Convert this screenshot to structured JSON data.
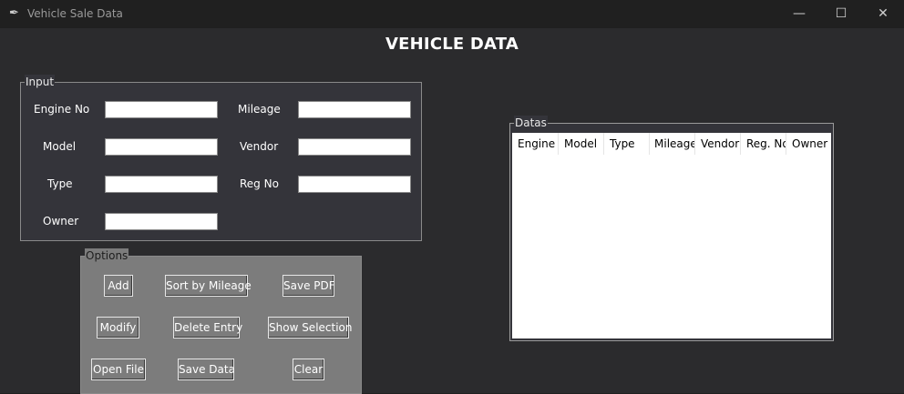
{
  "window": {
    "title": "Vehicle Sale Data",
    "controls": {
      "minimize": "—",
      "maximize": "☐",
      "close": "✕"
    }
  },
  "heading": "VEHICLE DATA",
  "input_frame": {
    "label": "Input",
    "fields": {
      "engine_no": {
        "label": "Engine No",
        "value": ""
      },
      "mileage": {
        "label": "Mileage",
        "value": ""
      },
      "model": {
        "label": "Model",
        "value": ""
      },
      "vendor": {
        "label": "Vendor",
        "value": ""
      },
      "type": {
        "label": "Type",
        "value": ""
      },
      "reg_no": {
        "label": "Reg No",
        "value": ""
      },
      "owner": {
        "label": "Owner",
        "value": ""
      }
    }
  },
  "options_frame": {
    "label": "Options",
    "buttons": {
      "add": "Add",
      "sort_mileage": "Sort by Mileage",
      "save_pdf": "Save PDF",
      "modify": "Modify",
      "delete_entry": "Delete Entry",
      "show_selection": "Show Selection",
      "open_file": "Open File",
      "save_data": "Save Data",
      "clear": "Clear"
    }
  },
  "data_frame": {
    "label": "Datas",
    "columns": [
      "Engine N",
      "Model",
      "Type",
      "Mileage",
      "Vendor",
      "Reg. No",
      "Owner"
    ],
    "rows": []
  },
  "colors": {
    "background": "#202020",
    "panel": "#34343a",
    "options_panel": "#7c7c7c",
    "text": "#ffffff"
  }
}
